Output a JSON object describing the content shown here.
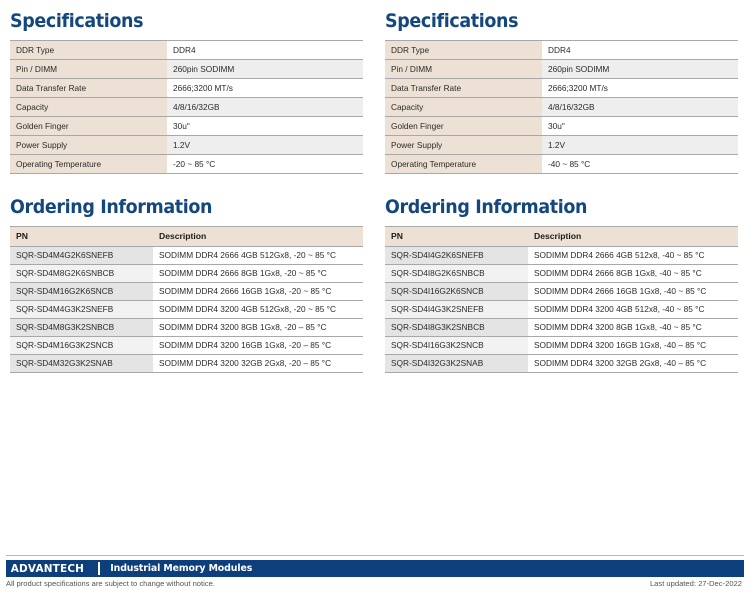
{
  "left": {
    "spec_title": "Specifications",
    "spec_rows": [
      {
        "label": "DDR Type",
        "value": "DDR4"
      },
      {
        "label": "Pin / DIMM",
        "value": "260pin SODIMM"
      },
      {
        "label": "Data Transfer Rate",
        "value": "2666;3200 MT/s"
      },
      {
        "label": "Capacity",
        "value": "4/8/16/32GB"
      },
      {
        "label": "Golden Finger",
        "value": "30u\""
      },
      {
        "label": "Power Supply",
        "value": "1.2V"
      },
      {
        "label": "Operating Temperature",
        "value": "-20 ~ 85 °C"
      }
    ],
    "order_title": "Ordering Information",
    "order_headers": {
      "pn": "PN",
      "description": "Description"
    },
    "order_rows": [
      {
        "pn": "SQR-SD4M4G2K6SNEFB",
        "description": "SODIMM DDR4 2666 4GB 512Gx8, -20 ~ 85 °C"
      },
      {
        "pn": "SQR-SD4M8G2K6SNBCB",
        "description": "SODIMM DDR4 2666 8GB 1Gx8, -20 ~ 85 °C"
      },
      {
        "pn": "SQR-SD4M16G2K6SNCB",
        "description": "SODIMM DDR4 2666 16GB 1Gx8, -20 ~ 85 °C"
      },
      {
        "pn": "SQR-SD4M4G3K2SNEFB",
        "description": "SODIMM DDR4 3200 4GB  512Gx8, -20 ~ 85 °C"
      },
      {
        "pn": "SQR-SD4M8G3K2SNBCB",
        "description": "SODIMM DDR4 3200 8GB  1Gx8, -20 – 85 °C"
      },
      {
        "pn": "SQR-SD4M16G3K2SNCB",
        "description": "SODIMM DDR4 3200 16GB 1Gx8, -20 – 85 °C"
      },
      {
        "pn": "SQR-SD4M32G3K2SNAB",
        "description": "SODIMM DDR4 3200 32GB 2Gx8, -20 – 85 °C"
      }
    ]
  },
  "right": {
    "spec_title": "Specifications",
    "spec_rows": [
      {
        "label": "DDR Type",
        "value": "DDR4"
      },
      {
        "label": "Pin / DIMM",
        "value": "260pin SODIMM"
      },
      {
        "label": "Data Transfer Rate",
        "value": "2666;3200 MT/s"
      },
      {
        "label": "Capacity",
        "value": "4/8/16/32GB"
      },
      {
        "label": "Golden Finger",
        "value": "30u\""
      },
      {
        "label": "Power Supply",
        "value": "1.2V"
      },
      {
        "label": "Operating Temperature",
        "value": "-40 ~ 85 °C"
      }
    ],
    "order_title": "Ordering Information",
    "order_headers": {
      "pn": "PN",
      "description": "Description"
    },
    "order_rows": [
      {
        "pn": "SQR-SD4I4G2K6SNEFB",
        "description": "SODIMM DDR4 2666 4GB 512x8, -40 ~ 85 °C"
      },
      {
        "pn": "SQR-SD4I8G2K6SNBCB",
        "description": "SODIMM DDR4 2666 8GB  1Gx8, -40 ~ 85 °C"
      },
      {
        "pn": "SQR-SD4I16G2K6SNCB",
        "description": "SODIMM DDR4 2666 16GB 1Gx8, -40 ~ 85 °C"
      },
      {
        "pn": "SQR-SD4I4G3K2SNEFB",
        "description": "SODIMM DDR4 3200 4GB 512x8, -40 ~ 85 °C"
      },
      {
        "pn": "SQR-SD4I8G3K2SNBCB",
        "description": "SODIMM DDR4 3200 8GB 1Gx8, -40 ~ 85 °C"
      },
      {
        "pn": "SQR-SD4I16G3K2SNCB",
        "description": "SODIMM DDR4 3200 16GB 1Gx8, -40 – 85 °C"
      },
      {
        "pn": "SQR-SD4I32G3K2SNAB",
        "description": "SODIMM DDR4 3200 32GB 2Gx8, -40 – 85 °C"
      }
    ]
  },
  "footer": {
    "logo_text": "ADVANTECH",
    "tagline": "Industrial Memory Modules",
    "disclaimer": "All product specifications are subject to change without notice.",
    "last_updated": "Last updated: 27-Dec-2022"
  },
  "colors": {
    "heading_blue": "#14477d",
    "footer_blue": "#0d3f7d",
    "label_beige": "#ece1d4",
    "row_gray": "#eeeeee",
    "rule_gray": "#a8a8a8"
  }
}
